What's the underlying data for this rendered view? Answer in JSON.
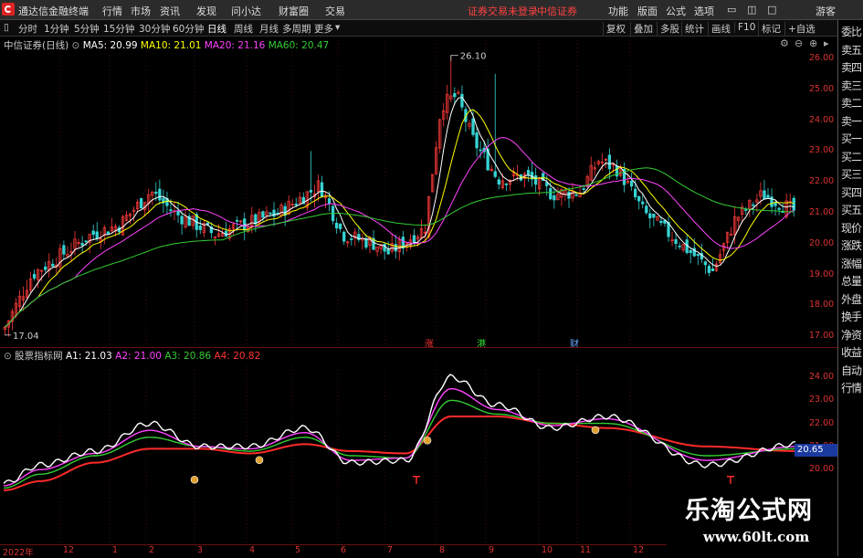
{
  "topbar": {
    "app_name": "通达信金融终端",
    "menu": [
      "行情",
      "市场",
      "资讯",
      "发现",
      "问小达",
      "财富圈",
      "交易"
    ],
    "notice1": "证券交易未登录",
    "notice2": "中信证券",
    "right_menu": [
      "功能",
      "版面",
      "公式",
      "选项"
    ],
    "guest": "游客"
  },
  "periodbar": {
    "items": [
      "分时",
      "1分钟",
      "5分钟",
      "15分钟",
      "30分钟",
      "60分钟",
      "日线",
      "周线",
      "月线",
      "多周期",
      "更多"
    ],
    "selected": "日线",
    "tools": [
      "复权",
      "叠加",
      "多股",
      "统计",
      "画线",
      "F10",
      "标记",
      "+自选"
    ]
  },
  "rightpanel": {
    "items": [
      "委比",
      "卖五",
      "卖四",
      "卖三",
      "卖二",
      "卖一",
      "买一",
      "买二",
      "买三",
      "买四",
      "买五",
      "现价",
      "涨跌",
      "涨幅",
      "总量",
      "外盘",
      "换手",
      "净资",
      "收益",
      "自动",
      "行情"
    ]
  },
  "main_info": {
    "title": "中信证券(日线)",
    "ma5": "MA5: 20.99",
    "ma10": "MA10: 21.01",
    "ma20": "MA20: 21.16",
    "ma60": "MA60: 20.47",
    "high_label": "26.10",
    "low_label": "17.04",
    "colors": {
      "ma5": "#ffffff",
      "ma10": "#ffff00",
      "ma20": "#ff44ff",
      "ma60": "#33cc33"
    }
  },
  "main_axis": [
    "26.00",
    "25.00",
    "24.00",
    "23.00",
    "22.00",
    "21.00",
    "20.00",
    "19.00",
    "18.00",
    "17.00"
  ],
  "markers": [
    "涨",
    "港",
    "财"
  ],
  "sub_info": {
    "title": "股票指标网",
    "a1": "A1: 21.03",
    "a2": "A2: 21.00",
    "a3": "A3: 20.86",
    "a4": "A4: 20.82",
    "current": "20.65"
  },
  "sub_axis": [
    "24.00",
    "23.00",
    "22.00",
    "21.00",
    "20.00"
  ],
  "date_axis": [
    "2022年",
    "12",
    "1",
    "2",
    "3",
    "4",
    "5",
    "6",
    "7",
    "8",
    "9",
    "10",
    "11",
    "12"
  ],
  "watermark": {
    "brand": "乐淘公式网",
    "url": "www.60lt.com"
  },
  "chart_data": [
    {
      "type": "candlestick",
      "title": "中信证券(日线)",
      "ylim": [
        16.8,
        26.4
      ],
      "x": [
        "2022-11",
        "2022-12",
        "2023-01",
        "2023-02",
        "2023-03",
        "2023-04",
        "2023-05",
        "2023-06",
        "2023-07",
        "2023-08",
        "2023-09",
        "2023-10",
        "2023-11",
        "2023-12"
      ],
      "close_approx": [
        17.3,
        19.3,
        20.2,
        21.8,
        20.2,
        20.7,
        21.7,
        20.0,
        20.3,
        24.8,
        22.2,
        21.7,
        22.7,
        19.6,
        20.8
      ],
      "series": [
        {
          "name": "MA5",
          "last": 20.99
        },
        {
          "name": "MA10",
          "last": 21.01
        },
        {
          "name": "MA20",
          "last": 21.16
        },
        {
          "name": "MA60",
          "last": 20.47
        }
      ],
      "annotations": [
        {
          "text": "26.10",
          "type": "high"
        },
        {
          "text": "17.04",
          "type": "low"
        }
      ]
    },
    {
      "type": "line",
      "title": "股票指标网",
      "ylim": [
        19.6,
        24.6
      ],
      "series": [
        {
          "name": "A1",
          "last": 21.03,
          "values": [
            19.4,
            20.2,
            20.8,
            22.0,
            21.0,
            21.0,
            21.8,
            20.3,
            20.4,
            24.0,
            22.8,
            21.8,
            22.3,
            20.2,
            21.1
          ]
        },
        {
          "name": "A2",
          "last": 21.0,
          "values": [
            19.3,
            20.0,
            20.7,
            21.7,
            21.0,
            20.9,
            21.6,
            20.4,
            20.5,
            23.5,
            22.6,
            21.9,
            22.2,
            20.4,
            21.0
          ]
        },
        {
          "name": "A3",
          "last": 20.86,
          "values": [
            19.2,
            19.8,
            20.6,
            21.4,
            21.0,
            20.8,
            21.4,
            20.6,
            20.5,
            23.0,
            22.4,
            22.0,
            22.0,
            20.6,
            20.9
          ]
        },
        {
          "name": "A4",
          "last": 20.82,
          "values": [
            19.1,
            19.5,
            20.3,
            20.9,
            20.9,
            20.7,
            21.1,
            20.8,
            20.7,
            22.3,
            22.3,
            22.0,
            21.8,
            21.0,
            20.8
          ]
        }
      ]
    }
  ]
}
